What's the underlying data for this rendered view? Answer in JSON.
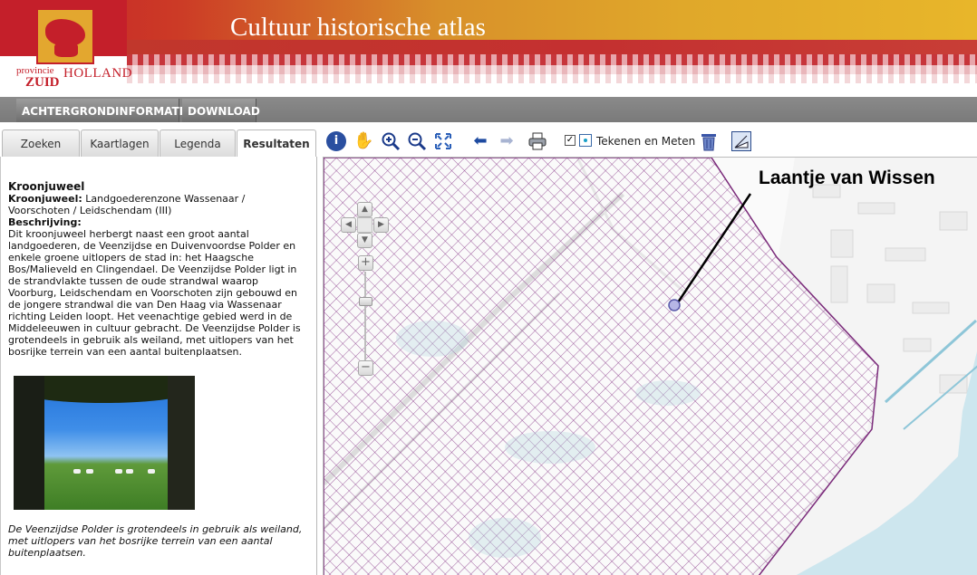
{
  "header": {
    "logo_line1": "provincie",
    "logo_line2": "HOLLAND",
    "logo_line3": "ZUID",
    "title": "Cultuur historische atlas",
    "colors": {
      "red": "#c41f2a",
      "gold": "#e3a72f"
    }
  },
  "nav": {
    "items": [
      {
        "label": "ACHTERGRONDINFORMATIE"
      },
      {
        "label": "DOWNLOAD"
      }
    ]
  },
  "tabs": [
    {
      "label": "Zoeken"
    },
    {
      "label": "Kaartlagen"
    },
    {
      "label": "Legenda"
    },
    {
      "label": "Resultaten",
      "active": true
    }
  ],
  "result": {
    "title": "Kroonjuweel",
    "field_label": "Kroonjuweel:",
    "field_value": "Landgoederenzone Wassenaar / Voorschoten / Leidschendam (III)",
    "desc_label": "Beschrijving:",
    "description": "Dit kroonjuweel herbergt naast een groot aantal landgoederen, de Veenzijdse en Duivenvoordse Polder en enkele groene uitlopers de stad in: het Haagsche Bos/Malieveld en Clingendael. De Veenzijdse Polder ligt in de strandvlakte tussen de oude strandwal waarop Voorburg, Leidschendam en Voorschoten zijn gebouwd en de jongere strandwal die van Den Haag via Wassenaar richting Leiden loopt. Het veenachtige gebied werd in de Middeleeuwen in cultuur gebracht. De Veenzijdse Polder is grotendeels in gebruik als weiland, met uitlopers van het bosrijke terrein van een aantal buitenplaatsen.",
    "caption": "De Veenzijdse Polder is grotendeels in gebruik als weiland, met uitlopers van het bosrijke terrein van een aantal buitenplaatsen."
  },
  "toolbar": {
    "icons": [
      "info-icon",
      "pan-hand-icon",
      "zoom-in-icon",
      "zoom-out-icon",
      "full-extent-icon",
      "back-arrow-icon",
      "forward-arrow-icon",
      "print-icon",
      "draw-icon",
      "trash-icon",
      "measure-icon"
    ],
    "tekenen_checked": true,
    "tekenen_label": "Tekenen en Meten"
  },
  "map": {
    "annotation": "Laantje van Wissen",
    "hatch_color": "#7a2a7a",
    "water_color": "#c8e4ec"
  }
}
